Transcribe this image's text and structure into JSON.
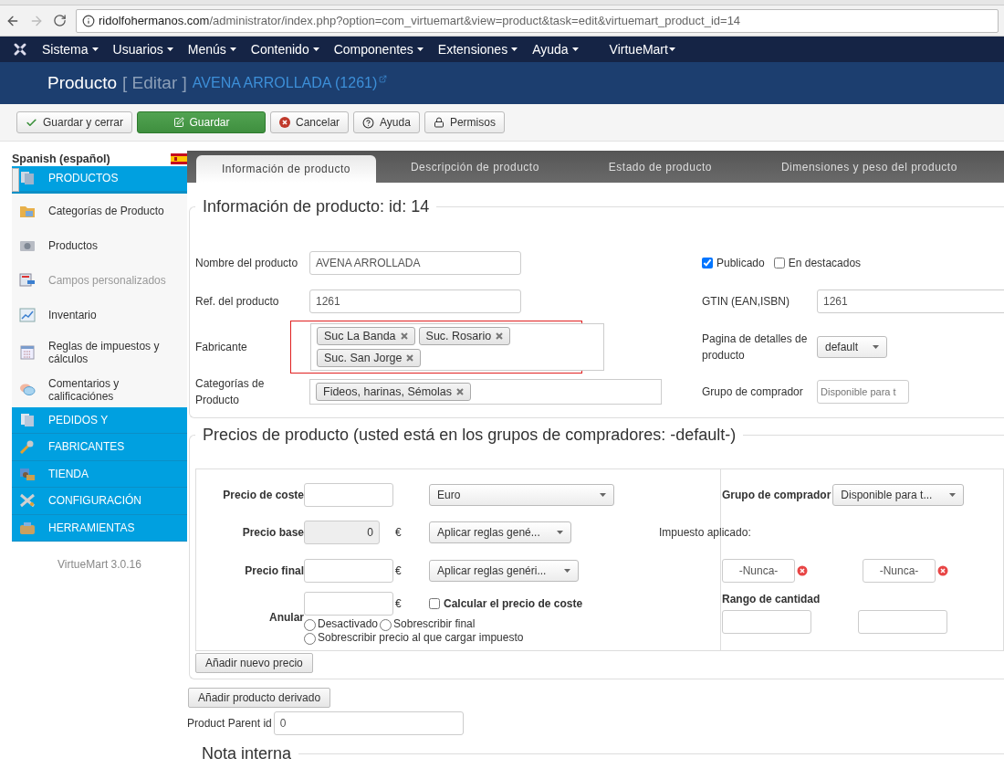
{
  "browser": {
    "url_host": "ridolfohermanos.com",
    "url_path": "/administrator/index.php?option=com_virtuemart&view=product&task=edit&virtuemart_product_id=14"
  },
  "menu": [
    {
      "label": "Sistema"
    },
    {
      "label": "Usuarios"
    },
    {
      "label": "Menús"
    },
    {
      "label": "Contenido"
    },
    {
      "label": "Componentes"
    },
    {
      "label": "Extensiones"
    },
    {
      "label": "Ayuda"
    },
    {
      "label": "VirtueMart"
    }
  ],
  "header": {
    "title": "Producto",
    "action": "[ Editar ]",
    "product": "AVENA ARROLLADA (1261)"
  },
  "toolbar": [
    {
      "label": "Guardar y cerrar",
      "kind": "check",
      "primary": false
    },
    {
      "label": "Guardar",
      "kind": "edit",
      "primary": true
    },
    {
      "label": "Cancelar",
      "kind": "cancel",
      "primary": false
    },
    {
      "label": "Ayuda",
      "kind": "help",
      "primary": false
    },
    {
      "label": "Permisos",
      "kind": "lock",
      "primary": false
    }
  ],
  "sidebar": {
    "language": "Spanish (español)",
    "sections": [
      {
        "label": "PRODUCTOS",
        "expanded": true,
        "items": [
          {
            "label": "Categorías de Producto",
            "disabled": false
          },
          {
            "label": "Productos",
            "disabled": false
          },
          {
            "label": "Campos personalizados",
            "disabled": true
          },
          {
            "label": "Inventario",
            "disabled": false
          },
          {
            "label": "Reglas de impuestos y cálculos",
            "disabled": false
          },
          {
            "label": "Comentarios y calificaciónes",
            "disabled": false
          }
        ]
      },
      {
        "label": "PEDIDOS Y"
      },
      {
        "label": "FABRICANTES"
      },
      {
        "label": "TIENDA"
      },
      {
        "label": "CONFIGURACIÓN"
      },
      {
        "label": "HERRAMIENTAS"
      }
    ],
    "version": "VirtueMart 3.0.16"
  },
  "tabs": [
    {
      "label": "Información de producto",
      "selected": true
    },
    {
      "label": "Descripción de producto",
      "selected": false
    },
    {
      "label": "Estado de producto",
      "selected": false
    },
    {
      "label": "Dimensiones y peso del producto",
      "selected": false
    }
  ],
  "info": {
    "title": "Información de producto: id: 14",
    "name": {
      "label": "Nombre del producto",
      "value": "AVENA ARROLLADA"
    },
    "sku": {
      "label": "Ref. del producto",
      "value": "1261"
    },
    "manufacturer": {
      "label": "Fabricante",
      "tags": [
        "Suc La Banda",
        "Suc. Rosario",
        "Suc. San Jorge"
      ],
      "highlighted": true
    },
    "categories": {
      "label": "Categorías de Producto",
      "tags": [
        "Fideos, harinas, Sémolas"
      ]
    },
    "published": {
      "label": "Publicado",
      "checked": true
    },
    "featured": {
      "label": "En destacados",
      "checked": false
    },
    "gtin": {
      "label": "GTIN (EAN,ISBN)",
      "value": "1261"
    },
    "page": {
      "label": "Pagina de detalles de producto",
      "value": "default"
    },
    "group": {
      "label": "Grupo de comprador",
      "placeholder": "Disponible para t"
    }
  },
  "prices": {
    "title": "Precios de producto (usted está en los grupos de compradores: -default-)",
    "cost": {
      "label": "Precio de coste",
      "currency": "Euro"
    },
    "group": {
      "label": "Grupo de comprador",
      "value": "Disponible para t..."
    },
    "base": {
      "label": "Precio base",
      "value": "0",
      "sign": "€",
      "rules": "Aplicar reglas gené..."
    },
    "tax_label": "Impuesto aplicado:",
    "final": {
      "label": "Precio final",
      "sign": "€",
      "rules": "Aplicar reglas genéri..."
    },
    "dates": [
      "-Nunca-",
      "-Nunca-"
    ],
    "override": {
      "label": "Anular",
      "sign": "€",
      "calc_label": "Calcular el precio de coste",
      "calc_checked": false,
      "options": [
        {
          "label": "Desactivado",
          "selected": false
        },
        {
          "label": "Sobrescribir final",
          "selected": false
        },
        {
          "label": "Sobrescribir precio al que cargar impuesto",
          "selected": false
        }
      ]
    },
    "quantity_label": "Rango de cantidad",
    "add_price": "Añadir nuevo precio"
  },
  "derived_button": "Añadir producto derivado",
  "parent": {
    "label": "Product Parent id",
    "value": "0"
  },
  "note_title": "Nota interna"
}
